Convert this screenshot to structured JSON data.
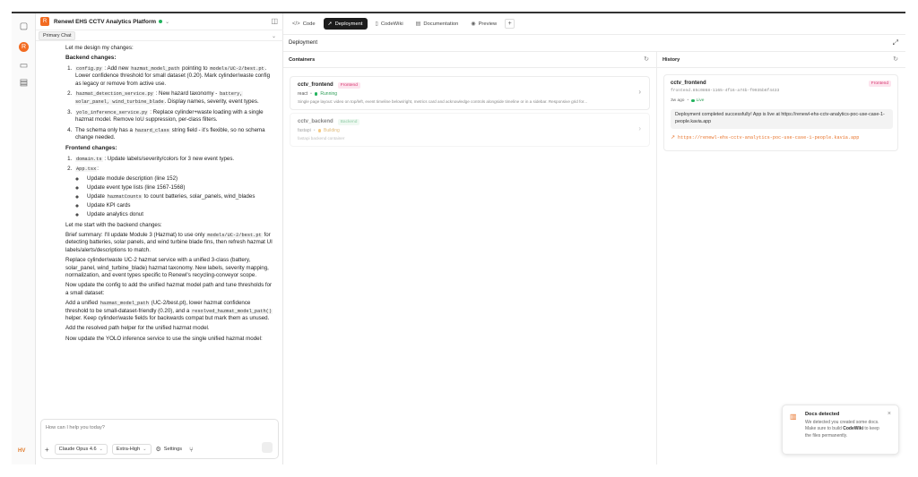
{
  "app": {
    "project_name": "Renewl EHS CCTV Analytics Platform",
    "brand_initial": "R",
    "user_initials": "HV",
    "status_color": "#22b35e",
    "accent_color": "#f26b21"
  },
  "rail": {
    "icons": [
      "panel-icon",
      "avatar-icon",
      "chat-icon",
      "briefcase-icon"
    ]
  },
  "chat": {
    "tab_label": "Primary Chat",
    "messages": {
      "intro": "Let me design my changes:",
      "backend_heading": "Backend changes:",
      "b1_code1": "config.py",
      "b1_text1": ": Add new",
      "b1_code2": "hazmat_model_path",
      "b1_text2": "pointing to",
      "b1_code3": "models/UC-2/best.pt",
      "b1_text3": ". Lower confidence threshold for small dataset (0.20). Mark cylinder/waste config as legacy or remove from active use.",
      "b2_code1": "hazmat_detection_service.py",
      "b2_text1": ": New hazard taxonomy -",
      "b2_code2": "battery, solar_panel, wind_turbine_blade",
      "b2_text2": ". Display names, severity, event types.",
      "b3_code1": "yolo_inference_service.py",
      "b3_text1": ": Replace cylinder+waste loading with a single hazmat model. Remove IoU suppression, per-class filters.",
      "b4_text1": "The schema only has a",
      "b4_code1": "hazard_class",
      "b4_text2": "string field - it's flexible, so no schema change needed.",
      "frontend_heading": "Frontend changes:",
      "f1_code1": "domain.ts",
      "f1_text1": ": Update labels/severity/colors for 3 new event types.",
      "f2_code1": "App.tsx",
      "f2_text1": ":",
      "f2_sub1": "Update module description (line 152)",
      "f2_sub2": "Update event type lists (line 1567-1568)",
      "f2_sub3_pre": "Update",
      "f2_sub3_code": "hazmatCounts",
      "f2_sub3_post": "to count batteries, solar_panels, wind_blades",
      "f2_sub4": "Update KPI cards",
      "f2_sub5": "Update analytics donut",
      "start": "Let me start with the backend changes:",
      "summary_pre": "Brief summary: I'll update Module 3 (Hazmat) to use only",
      "summary_code": "models/UC-2/best.pt",
      "summary_post": "for detecting batteries, solar panels, and wind turbine blade fins, then refresh hazmat UI labels/alerts/descriptions to match.",
      "replace": "Replace cylinder/waste UC-2 hazmat service with a unified 3-class (battery, solar_panel, wind_turbine_blade) hazmat taxonomy. New labels, severity mapping, normalization, and event types specific to Renewl's recycling-conveyor scope.",
      "config_update": "Now update the config to add the unified hazmat model path and tune thresholds for a small dataset:",
      "add_pre": "Add a unified",
      "add_code1": "hazmat_model_path",
      "add_mid": "(UC-2/best.pt), lower hazmat confidence threshold to be small-dataset-friendly (0.20), and a",
      "add_code2": "resolved_hazmat_model_path()",
      "add_post": "helper. Keep cylinder/waste fields for backwards compat but mark them as unused.",
      "helper": "Add the resolved path helper for the unified hazmat model.",
      "yolo_update": "Now update the YOLO inference service to use the single unified hazmat model:"
    },
    "composer": {
      "placeholder": "How can I help you today?",
      "model": "Claude Opus 4.6",
      "effort": "Extra-High",
      "settings": "Settings"
    }
  },
  "top_tabs": [
    {
      "label": "Code",
      "icon": "code-icon",
      "active": false
    },
    {
      "label": "Deployment",
      "icon": "rocket-icon",
      "active": true
    },
    {
      "label": "CodeWiki",
      "icon": "book-icon",
      "active": false
    },
    {
      "label": "Documentation",
      "icon": "document-icon",
      "active": false
    },
    {
      "label": "Preview",
      "icon": "eye-icon",
      "active": false
    }
  ],
  "deployment": {
    "title": "Deployment",
    "containers_title": "Containers",
    "history_title": "History",
    "containers": [
      {
        "name": "cctv_frontend",
        "tag": "Frontend",
        "framework": "react",
        "status": "Running",
        "status_color": "#22b35e",
        "description": "Single page layout: video on top/left, event timeline below/right, metrics card and acknowledge controls alongside timeline or in a sidebar. Responsive grid for..."
      },
      {
        "name": "cctv_backend",
        "tag": "Backend",
        "framework": "fastapi",
        "status": "Building",
        "status_color": "#f0a020",
        "description": "fastapi backend container"
      }
    ],
    "history": {
      "name": "cctv_frontend",
      "tag": "Frontend",
      "id": "frontend.85c0868-1165-4f16-a74b-f9935b6f4433",
      "time": "3w ago",
      "status": "Live",
      "message": "Deployment completed successfully! App is live at https://renewl-ehs-cctv-analytics-poc-use-case-1-people.kavia.app",
      "url": "https://renewl-ehs-cctv-analytics-poc-use-case-1-people.kavia.app"
    }
  },
  "toast": {
    "title": "Docs detected",
    "body_pre": "We detected you created some docs. Make sure to build",
    "body_bold": "CodeWiki",
    "body_post": "to keep the files permanently."
  }
}
